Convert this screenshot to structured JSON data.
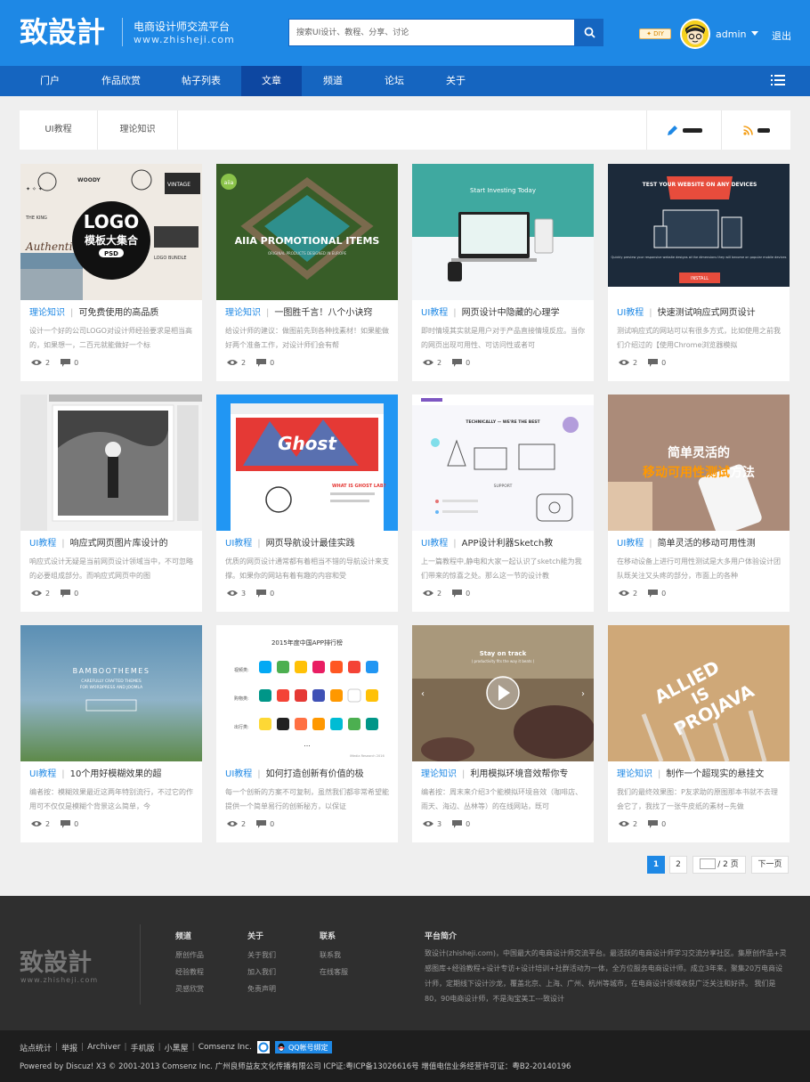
{
  "header": {
    "logo_text": "致設計",
    "slogan": "电商设计师交流平台",
    "url_text": "www.zhisheji.com",
    "search_placeholder": "搜索UI设计、教程、分享、讨论",
    "diy_label": "DIY",
    "username": "admin",
    "logout_label": "退出"
  },
  "nav": {
    "items": [
      "门户",
      "作品欣赏",
      "帖子列表",
      "文章",
      "频道",
      "论坛",
      "关于"
    ],
    "active": "文章"
  },
  "subnav": {
    "tabs": [
      "UI教程",
      "理论知识"
    ]
  },
  "articles": [
    {
      "category": "理论知识",
      "title": "可免费使用的高品质",
      "desc": "设计一个好的公司LOGO对设计师经验要求是相当高的，如果想一，二百元就能做好一个标",
      "views": "2",
      "comments": "0"
    },
    {
      "category": "理论知识",
      "title": "一图胜千言！八个小诀窍",
      "desc": "给设计师的建议：做图前先到各种找素材！如果能做好两个准备工作，对设计师们会有帮",
      "views": "2",
      "comments": "0"
    },
    {
      "category": "UI教程",
      "title": "网页设计中隐藏的心理学",
      "desc": "即时情境其实就是用户对于产品直接情境反应。当你的网页出现可用性、可访问性或者可",
      "views": "2",
      "comments": "0"
    },
    {
      "category": "UI教程",
      "title": "快速测试响应式网页设计",
      "desc": "测试响应式的网站可以有很多方式，比如使用之前我们介绍过的【使用Chrome浏览器模拟",
      "views": "2",
      "comments": "0"
    },
    {
      "category": "UI教程",
      "title": "响应式网页图片库设计的",
      "desc": "响应式设计无疑是当前网页设计领域当中，不可忽略的必要组成部分。而响应式网页中的图",
      "views": "2",
      "comments": "0"
    },
    {
      "category": "UI教程",
      "title": "网页导航设计最佳实践",
      "desc": "优质的网页设计通常都有着相当不错的导航设计来支撑。如果你的网站有着有趣的内容和受",
      "views": "3",
      "comments": "0"
    },
    {
      "category": "UI教程",
      "title": "APP设计利器Sketch教",
      "desc": "上一篇教程中,静电和大家一起认识了sketch能为我们带来的惊喜之处。那么这一节的设计教",
      "views": "2",
      "comments": "0"
    },
    {
      "category": "UI教程",
      "title": "简单灵活的移动可用性测",
      "desc": "在移动设备上进行可用性测试是大多用户体验设计团队既关注又头疼的部分，市面上的各种",
      "views": "2",
      "comments": "0"
    },
    {
      "category": "UI教程",
      "title": "10个用好模糊效果的超",
      "desc": "编者按：模糊效果最近这两年特别流行，不过它的作用可不仅仅是模糊个背景这么简单，今",
      "views": "2",
      "comments": "0"
    },
    {
      "category": "UI教程",
      "title": "如何打造创新有价值的极",
      "desc": "每一个创新的方案不可复制，虽然我们都非常希望能提供一个简单易行的创新秘方，以保证",
      "views": "2",
      "comments": "0"
    },
    {
      "category": "理论知识",
      "title": "利用模拟环境音效帮你专",
      "desc": "编者按：周末来介绍3个能模拟环境音效（咖啡店、雨天、海边、丛林等）的在线网站，既可",
      "views": "3",
      "comments": "0"
    },
    {
      "category": "理论知识",
      "title": "制作一个超现实的悬挂文",
      "desc": "我们的最终效果图：P友求助的原图那本书就不去理会它了，我找了一张牛皮纸的素材~先做",
      "views": "2",
      "comments": "0"
    }
  ],
  "thumb_text": {
    "logo_main": "LOGO",
    "logo_sub": "模板大集合",
    "logo_psd": "PSD",
    "woody": "WOODY",
    "vintage": "VINTAGE",
    "logo_bundle": "LOGO BUNDLE",
    "the_king": "THE KING",
    "authentic": "Authentic",
    "aiia_badge": "aiia",
    "aiia_title": "AIIA PROMOTIONAL ITEMS",
    "aiia_sub": "ORIGINAL PRODUCTS DESIGNED IN EUROPE",
    "invest_title": "Start Investing Today",
    "test_title": "TEST YOUR WEBSITE ON ANY DEVICES",
    "test_sub": "Quickly preview your responsive website designs at the dimensions they will become on popular mobile devices",
    "install": "INSTALL",
    "ghost": "Ghost",
    "ghost_label": "WHAT IS GHOST LAB?",
    "tech_title": "TECHNICALLY — WE'RE THE BEST",
    "support": "SUPPORT",
    "mobile_l1": "简单灵活的",
    "mobile_l2a": "移动可用性测试",
    "mobile_l2b": "方法",
    "bamboo_title": "BAMBOOTHEMES",
    "bamboo_sub1": "CAREFULLY CRAFTED THEMES",
    "bamboo_sub2": "FOR WORDPRESS AND JOOMLA",
    "rank_title": "2015年度中国APP排行榜",
    "rank_row1": "视频类:",
    "rank_row2": "购物类:",
    "rank_row3": "出行类:",
    "rank_source": "iMedia Research 2016",
    "stay_title": "Stay on track",
    "stay_sub": "( productivity fits the way it beats )",
    "allied_l1": "ALLIED",
    "allied_l2": "IS",
    "allied_l3": "PROJAVA"
  },
  "pagination": {
    "page1": "1",
    "page2": "2",
    "total": "/ 2 页",
    "next": "下一页"
  },
  "footer": {
    "logo_text": "致設計",
    "url_text": "www.zhisheji.com",
    "columns": [
      {
        "title": "频道",
        "links": [
          "原创作品",
          "经验教程",
          "灵感欣赏"
        ]
      },
      {
        "title": "关于",
        "links": [
          "关于我们",
          "加入我们",
          "免责声明"
        ]
      },
      {
        "title": "联系",
        "links": [
          "联系我",
          "在线客服"
        ]
      }
    ],
    "intro_title": "平台简介",
    "intro": "致设计(zhisheji.com)，中国最大的电商设计师交流平台。最活跃的电商设计师学习交流分享社区。集原创作品+灵感图库+经验教程+设计专访+设计培训+社群活动为一体，全方位服务电商设计师。成立3年来，聚集20万电商设计师，定期线下设计沙龙，覆盖北京、上海、广州、杭州等城市，在电商设计领域收获广泛关注和好评。 我们是80，90电商设计师，不是淘宝美工---致设计",
    "links": [
      "站点统计",
      "举报",
      "Archiver",
      "手机版",
      "小黑屋",
      "Comsenz Inc."
    ],
    "qq_label": "QQ帐号绑定",
    "copyright": "Powered by Discuz! X3 © 2001-2013 Comsenz Inc. 广州良师益友文化传播有限公司 ICP证:粤ICP备13026616号 增值电信业务经营许可证：粤B2-20140196"
  },
  "colors": {
    "brand": "#1e88e5",
    "nav_bg": "#1565c0",
    "nav_active": "#0d47a1",
    "footer_bg": "#2f2f2f"
  }
}
